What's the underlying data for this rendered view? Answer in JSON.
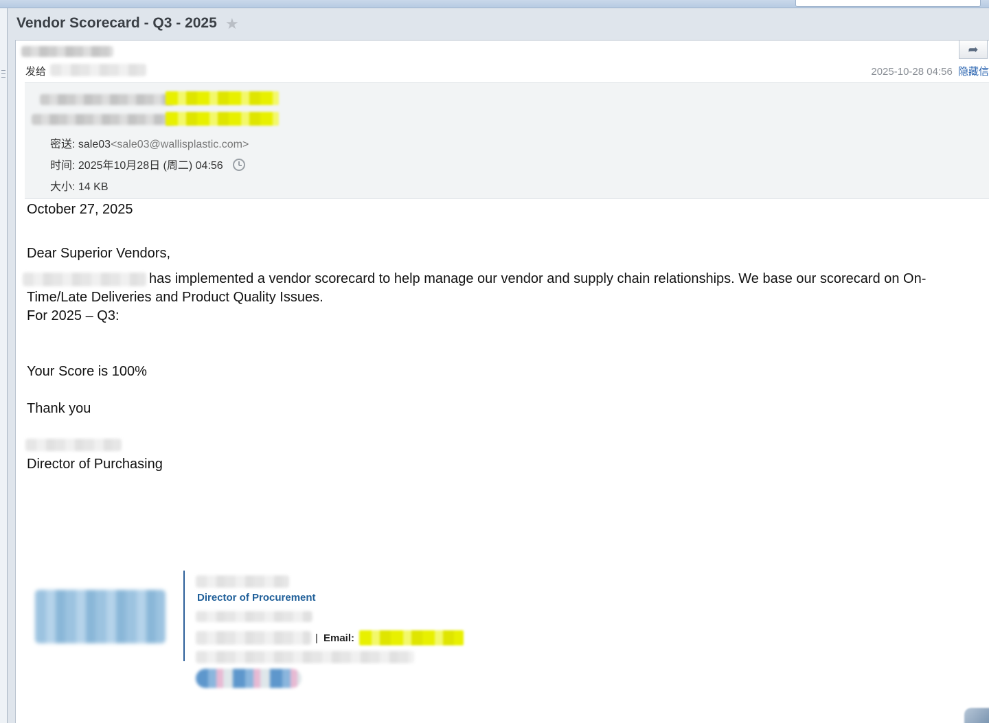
{
  "subject": {
    "title": "Vendor Scorecard - Q3 - 2025",
    "star_icon": "star-icon"
  },
  "header": {
    "to_label": "发给",
    "datetime": "2025-10-28 04:56",
    "hide_link": "隐藏信",
    "bcc_label": "密送:",
    "bcc_name": "sale03",
    "bcc_email": "<sale03@wallisplastic.com>",
    "time_label": "时间:",
    "time_value": "2025年10月28日 (周二) 04:56",
    "size_label": "大小:",
    "size_value": "14 KB"
  },
  "body": {
    "date": "October 27, 2025",
    "greeting": "Dear Superior Vendors,",
    "paragraph_line1": "has implemented a vendor scorecard to help manage our vendor and supply chain relationships.  We base our scorecard on On-",
    "paragraph_line2": "Time/Late Deliveries and Product Quality Issues.",
    "period": "For 2025 – Q3:",
    "score": "Your Score is 100%",
    "thanks": "Thank you",
    "signer_title": "Director of Purchasing"
  },
  "signature": {
    "title": "Director of Procurement",
    "separator": "|",
    "email_label": "Email:"
  },
  "icons": {
    "reply": "reply-icon",
    "history": "history-icon"
  },
  "colors": {
    "link": "#2a64b0",
    "signature_title": "#1f5f99",
    "highlight": "#e8f000"
  }
}
